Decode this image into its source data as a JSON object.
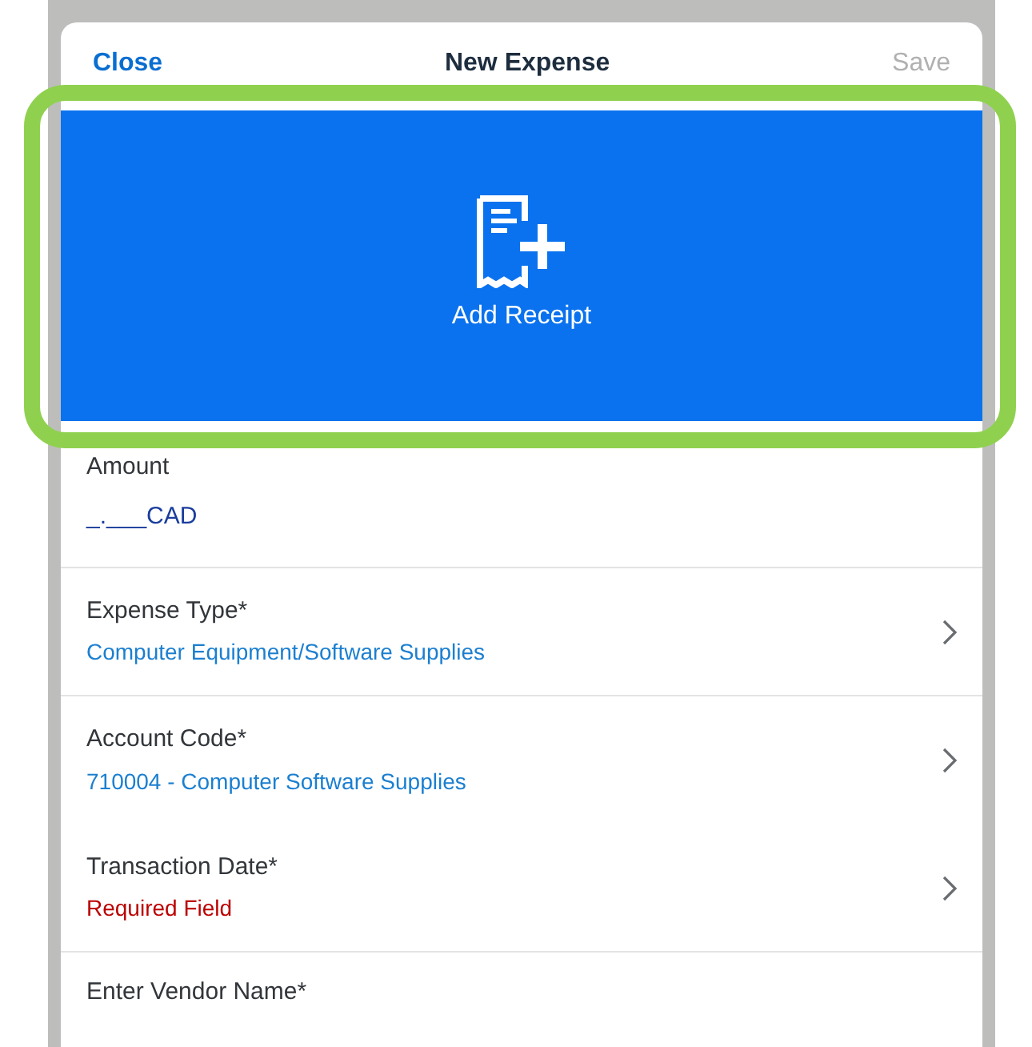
{
  "header": {
    "close": "Close",
    "title": "New Expense",
    "save": {
      "label": "Save",
      "disabled": true
    }
  },
  "receipt": {
    "label": "Add Receipt",
    "highlighted": true
  },
  "amount": {
    "label": "Amount",
    "value": "_.___",
    "currency": "CAD"
  },
  "fields": [
    {
      "label": "Expense Type*",
      "value": "Computer Equipment/Software Supplies",
      "kind": "picker",
      "required_missing": false,
      "divider_below": true
    },
    {
      "label": "Account Code*",
      "value": "710004 - Computer Software Supplies",
      "kind": "picker",
      "required_missing": false,
      "divider_below": false
    },
    {
      "label": "Transaction Date*",
      "value": "Required Field",
      "kind": "picker",
      "required_missing": true,
      "divider_below": true
    },
    {
      "label": "Enter Vendor Name*",
      "kind": "text"
    }
  ]
}
